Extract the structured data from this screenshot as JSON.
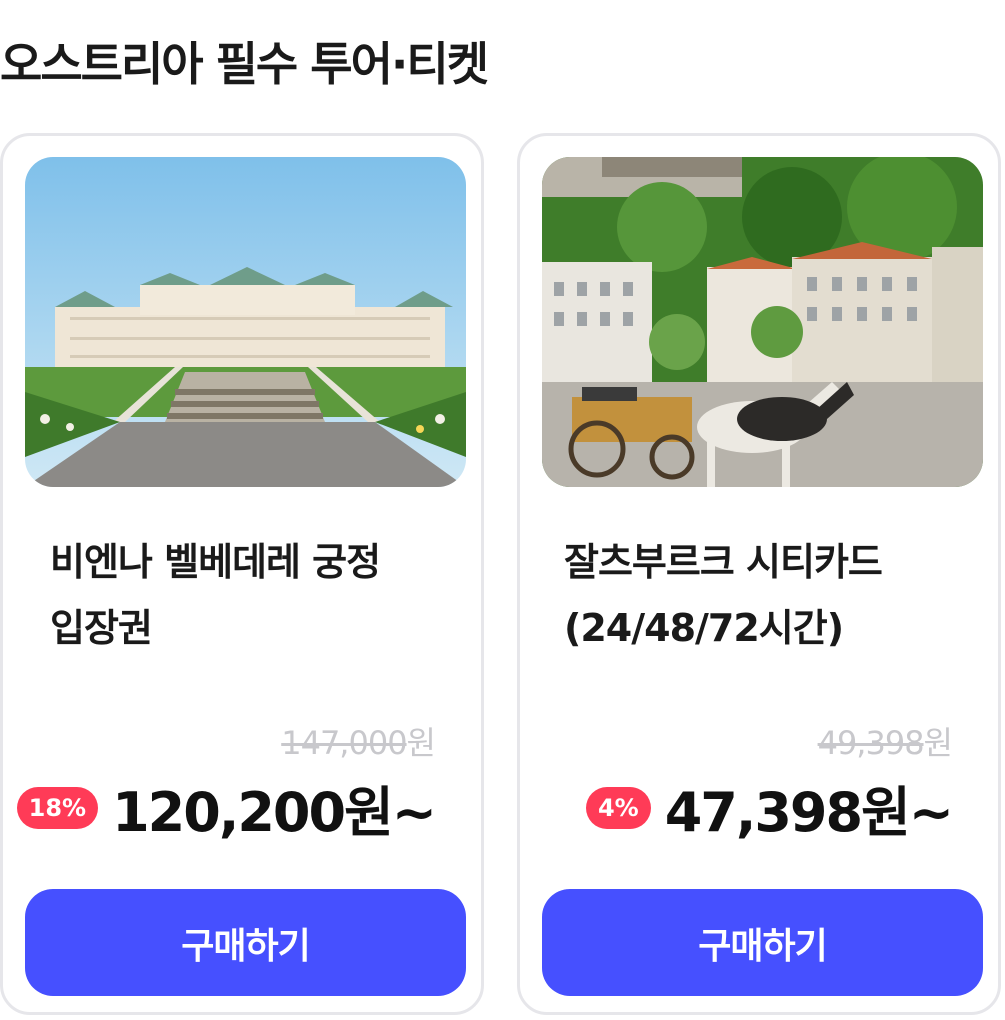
{
  "section": {
    "title": "오스트리아 필수 투어·티켓"
  },
  "products": [
    {
      "title_line1": "비엔나 벨베데레 궁정",
      "title_line2": "입장권",
      "original_price": "147,000",
      "original_unit": "원",
      "discount": "18%",
      "price": "120,200원~",
      "button": "구매하기",
      "image": "vienna-belvedere-palace-photo"
    },
    {
      "title_line1": "잘츠부르크 시티카드",
      "title_line2": "(24/48/72시간)",
      "original_price": "49,398",
      "original_unit": "원",
      "discount": "4%",
      "price": "47,398원~",
      "button": "구매하기",
      "image": "salzburg-horse-carriage-photo"
    }
  ],
  "colors": {
    "accent": "#4650ff",
    "discount_badge": "#ff3b57",
    "strikethrough": "#c8c8cc",
    "card_border": "#e6e6ea"
  }
}
